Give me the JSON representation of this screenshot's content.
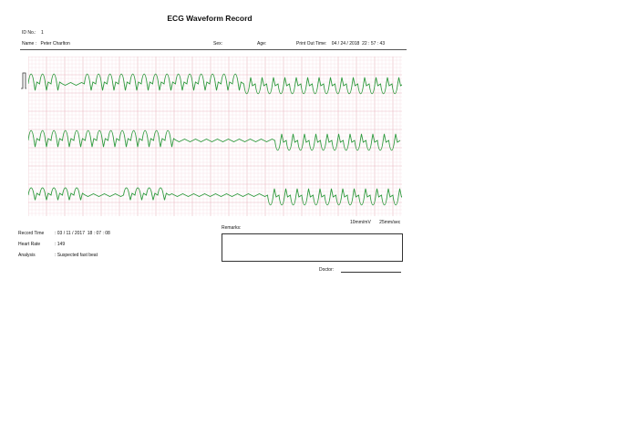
{
  "title": "ECG Waveform Record",
  "header": {
    "id_label": "ID No.:",
    "id_value": "1",
    "name_label": "Name :",
    "name_value": "Peter Charlton",
    "sex_label": "Sex:",
    "age_label": "Age:",
    "print_label": "Print Out Time:",
    "print_value": "04 / 24 / 2018  22 : 57 : 43"
  },
  "scale": {
    "gain": "10mm/mV",
    "speed": "25mm/sec"
  },
  "details": {
    "record_time_label": "Record Time",
    "record_time_value": ": 03 / 11 / 2017  18 : 07 : 08",
    "heart_rate_label": "Heart Rate",
    "heart_rate_value": ": 149",
    "analysis_label": "Analysis",
    "analysis_value": ": Suspected fast beat"
  },
  "remarks_label": "Remarks:",
  "doctor_label": "Doctor:",
  "colors": {
    "grid_minor": "#f6dde2",
    "grid_major": "#eab8c2",
    "trace": "#2f9a3e"
  }
}
